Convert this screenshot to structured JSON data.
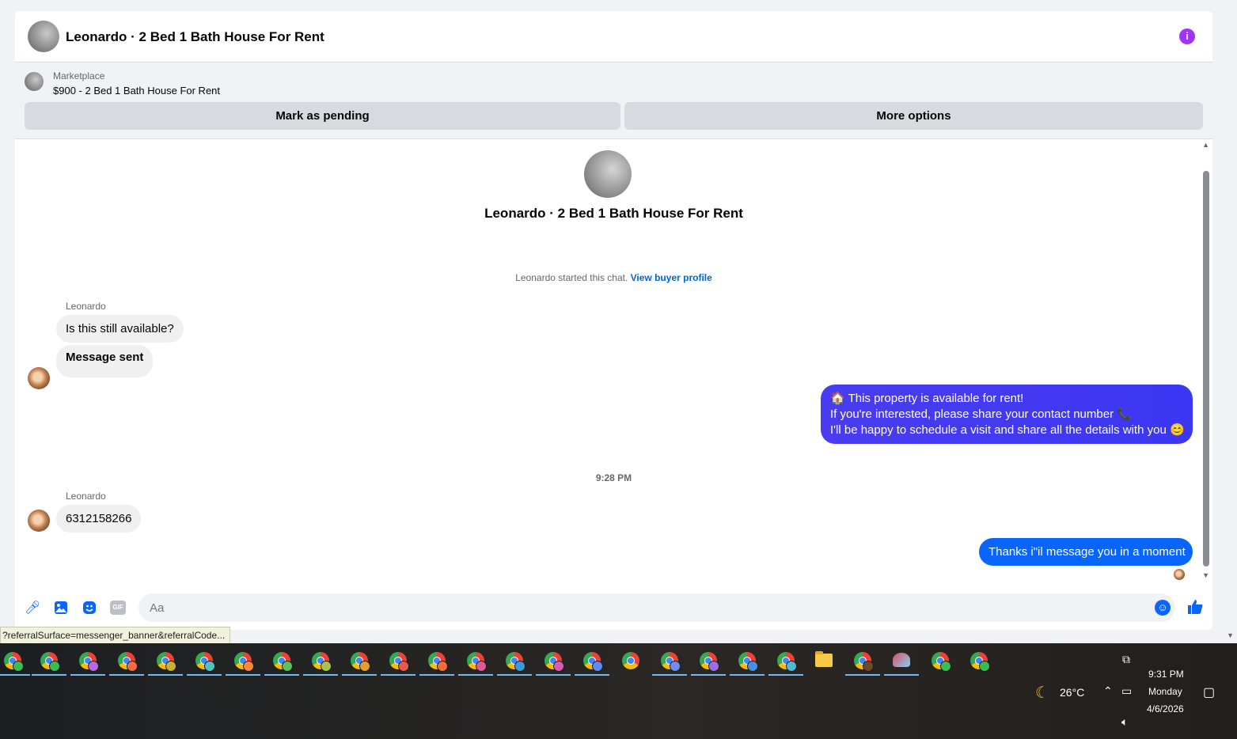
{
  "header": {
    "title": "Leonardo · 2 Bed 1 Bath House For Rent",
    "info_icon": "info-icon",
    "info_glyph": "i",
    "accent_color": "#a033ff"
  },
  "listing": {
    "source": "Marketplace",
    "price_title": "$900 - 2 Bed 1 Bath House For Rent",
    "pending_button": "Mark as pending",
    "more_button": "More options"
  },
  "conversation": {
    "title": "Leonardo · 2 Bed 1 Bath House For Rent",
    "started_text": "Leonardo started this chat.",
    "view_profile_link": "View buyer profile",
    "group1_sender": "Leonardo",
    "msg1": "Is this still available?",
    "msg2": "Message sent",
    "out1_line1": "🏠 This property is available for rent!",
    "out1_line2": "If you're interested, please share your contact number 📞",
    "out1_line3": "I'll be happy to schedule a visit and share all the details with you 😊",
    "timestamp": "9:28 PM",
    "group2_sender": "Leonardo",
    "msg3": "6312158266",
    "out2": "Thanks i\"il message you in a moment",
    "outgoing_color": "#0866ff",
    "outgoing_gradient_color": "#4a3cf0"
  },
  "composer": {
    "placeholder": "Aa",
    "icons": {
      "mic": "microphone-icon",
      "image": "image-icon",
      "sticker": "sticker-icon",
      "gif": "gif-icon",
      "emoji": "emoji-icon",
      "like": "thumbs-up-icon"
    },
    "gif_label": "GIF"
  },
  "status_bar": {
    "url": "?referralSurface=messenger_banner&referralCode..."
  },
  "taskbar": {
    "weather_temp": "26°C",
    "time": "9:31 PM",
    "day": "Monday",
    "date": "4/6/2026",
    "apps": [
      "chrome",
      "chrome",
      "chrome",
      "chrome",
      "chrome",
      "chrome",
      "chrome",
      "chrome",
      "chrome",
      "chrome",
      "chrome",
      "chrome",
      "chrome",
      "chrome",
      "chrome",
      "chrome",
      "chrome",
      "chrome",
      "chrome",
      "chrome",
      "chrome",
      "file-explorer",
      "chrome",
      "misc-app",
      "chrome",
      "chrome"
    ]
  }
}
